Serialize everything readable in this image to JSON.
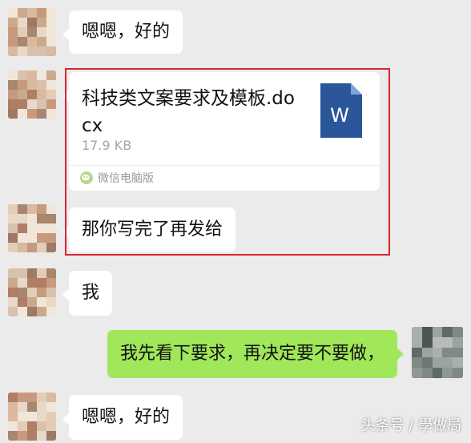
{
  "messages": [
    {
      "text": "嗯嗯，好的"
    },
    {
      "file": {
        "name": "科技类文案要求及模板.docx",
        "size": "17.9 KB",
        "source": "微信电脑版",
        "icon_letter": "W",
        "icon_color": "#2b579a"
      }
    },
    {
      "text": "那你写完了再发给"
    },
    {
      "text": "我"
    },
    {
      "text": "我先看下要求，再决定要不要做，"
    },
    {
      "text": "嗯嗯，好的"
    }
  ],
  "colors": {
    "background": "#ebebeb",
    "bubble_incoming": "#ffffff",
    "bubble_outgoing": "#a0e75a",
    "highlight_border": "#d8252e"
  },
  "watermark": "头条号 / 學做局"
}
